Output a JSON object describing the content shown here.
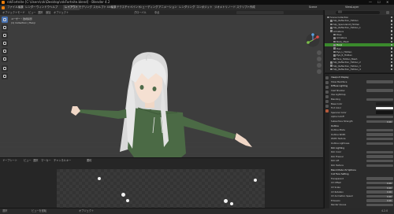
{
  "window": {
    "title": "rzkFortnite [C:\\Users\\rzk\\Desktop\\rzkFortnite.blend] - Blender 4.2",
    "controls": [
      "—",
      "☐",
      "✕"
    ]
  },
  "menubar": {
    "menus": [
      "ファイル",
      "編集",
      "レンダー",
      "ウィンドウ",
      "ヘルプ"
    ],
    "workspace_tabs": [
      "レイアウト",
      "モデリング",
      "スカルプト",
      "UV編集",
      "テクスチャペイント",
      "シェーディング",
      "アニメーション",
      "レンダリング",
      "コンポジット",
      "ジオメトリノード",
      "スクリプト作成"
    ],
    "active_tab_index": 0,
    "scene_label": "Scene",
    "viewlayer_label": "ViewLayer"
  },
  "viewport_header": {
    "mode": "オブジェクトモード",
    "items": [
      "ビュー",
      "選択",
      "追加",
      "オブジェクト"
    ],
    "orientation": "グローバル",
    "pivot": "中点"
  },
  "viewport": {
    "view_name": "ユーザー・透視投影",
    "collection_line": "(1) Collection | Hanji"
  },
  "bottom_header": {
    "editor": "ドープシート",
    "items": [
      "ビュー",
      "選択",
      "マーカー",
      "チャンネル",
      "キー"
    ],
    "summary": "要約"
  },
  "statusbar": {
    "left": [
      "選択",
      "ビューを回転",
      "オブジェクト"
    ],
    "right": "4.2.0"
  },
  "outliner": {
    "search_placeholder": "検索",
    "rows": [
      {
        "label": "Scene Collection",
        "indent": 0,
        "selected": false
      },
      {
        "label": "Sky_Reflection_Hidden",
        "indent": 1,
        "selected": false
      },
      {
        "label": "Sky_SpecularLit_Hidden",
        "indent": 1,
        "selected": false
      },
      {
        "label": "Sky_Reflection_Hidden_1",
        "indent": 1,
        "selected": false
      },
      {
        "label": "Armature",
        "indent": 1,
        "selected": false
      },
      {
        "label": "Pose",
        "indent": 2,
        "selected": false
      },
      {
        "label": "Armature",
        "indent": 2,
        "selected": false
      },
      {
        "label": "Body_Mesh",
        "indent": 2,
        "selected": false
      },
      {
        "label": "Hanji",
        "indent": 2,
        "selected": true
      },
      {
        "label": "Hair",
        "indent": 2,
        "selected": false
      },
      {
        "label": "Eye_L_Hidden",
        "indent": 2,
        "selected": false
      },
      {
        "label": "Eye_R_Hidden",
        "indent": 2,
        "selected": false
      },
      {
        "label": "Face_Hidden_Mesh",
        "indent": 2,
        "selected": false
      },
      {
        "label": "Sky_Reflection_Hidden_2",
        "indent": 1,
        "selected": false
      },
      {
        "label": "Sky_Reflection_Hidden_3",
        "indent": 1,
        "selected": false
      },
      {
        "label": "Sky_Reflection_Hidden_4",
        "indent": 1,
        "selected": false
      }
    ]
  },
  "properties": {
    "rows": [
      {
        "label": "Viewport Display",
        "type": "header"
      },
      {
        "label": "Show Backface",
        "type": "field",
        "value": ""
      },
      {
        "label": "Diffuse Lighting",
        "type": "header"
      },
      {
        "label": "Cast Shadow",
        "type": "field",
        "value": ""
      },
      {
        "label": "Use Lightmap",
        "type": "plain"
      },
      {
        "label": "Blending",
        "type": "field",
        "value": ""
      },
      {
        "label": "Base Color",
        "type": "swatch",
        "swatch": "#1e1e1e"
      },
      {
        "label": "Tint Color",
        "type": "swatch",
        "swatch": "#f0f0f0"
      },
      {
        "label": "Specular Color",
        "type": "swatch",
        "swatch": "#141414"
      },
      {
        "label": "Alpha Cutoff",
        "type": "field",
        "value": ""
      },
      {
        "label": "Subsurface Strength",
        "type": "field",
        "value": "0.00"
      },
      {
        "label": "Outline",
        "type": "header"
      },
      {
        "label": "Outline Mode",
        "type": "field",
        "value": ""
      },
      {
        "label": "Outline Width",
        "type": "field",
        "value": ""
      },
      {
        "label": "Width Texture",
        "type": "field",
        "value": ""
      },
      {
        "label": "Outline Lightness",
        "type": "field",
        "value": ""
      },
      {
        "label": "Rim Lighting",
        "type": "header"
      },
      {
        "label": "Rim Color",
        "type": "field",
        "value": ""
      },
      {
        "label": "Rim Fresnel",
        "type": "field",
        "value": ""
      },
      {
        "label": "Rim Lift",
        "type": "field",
        "value": ""
      },
      {
        "label": "Rim Texture",
        "type": "field",
        "value": ""
      },
      {
        "label": "Blend Mode UV Options",
        "type": "header"
      },
      {
        "label": "Cull Face Setting",
        "type": "header"
      },
      {
        "label": "Transparent",
        "type": "field",
        "value": ""
      },
      {
        "label": "UV Offset",
        "type": "field",
        "value": "0.00"
      },
      {
        "label": "UV Scale",
        "type": "field",
        "value": "0.00"
      },
      {
        "label": "UV Rotation",
        "type": "field",
        "value": "0.00"
      },
      {
        "label": "UV Animation Speed",
        "type": "field",
        "value": "0.00"
      },
      {
        "label": "Emission",
        "type": "field",
        "value": "0.00"
      },
      {
        "label": "Render Queue",
        "type": "field",
        "value": ""
      }
    ]
  },
  "colors": {
    "accent": "#4772b3",
    "selection_green": "#3a8a2c",
    "viewport_bg": "#3d3d3d",
    "hoodie": "#4b6a45",
    "hair": "#e4e4e4",
    "skin": "#f0d7c6"
  }
}
